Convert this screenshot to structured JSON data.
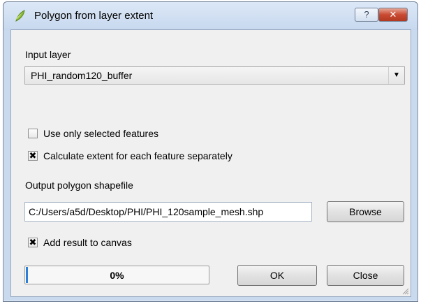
{
  "window": {
    "title": "Polygon from layer extent",
    "help_label": "?",
    "close_label": "✕",
    "icon": "qgis-icon"
  },
  "form": {
    "input_layer_label": "Input layer",
    "input_layer_value": "PHI_random120_buffer",
    "use_selected": {
      "label": "Use only selected features",
      "checked": false
    },
    "each_feature": {
      "label": "Calculate extent for each feature separately",
      "checked": true
    },
    "output_label": "Output polygon shapefile",
    "output_path": "C:/Users/a5d/Desktop/PHI/PHI_120sample_mesh.shp",
    "browse_label": "Browse",
    "add_result": {
      "label": "Add result to canvas",
      "checked": true
    }
  },
  "progress": {
    "value": 0,
    "text": "0%"
  },
  "buttons": {
    "ok_label": "OK",
    "close_label": "Close"
  },
  "colors": {
    "title_bar": "#c9d9ee",
    "close_button": "#c84a31",
    "progress_fill": "#2d7fd8"
  }
}
